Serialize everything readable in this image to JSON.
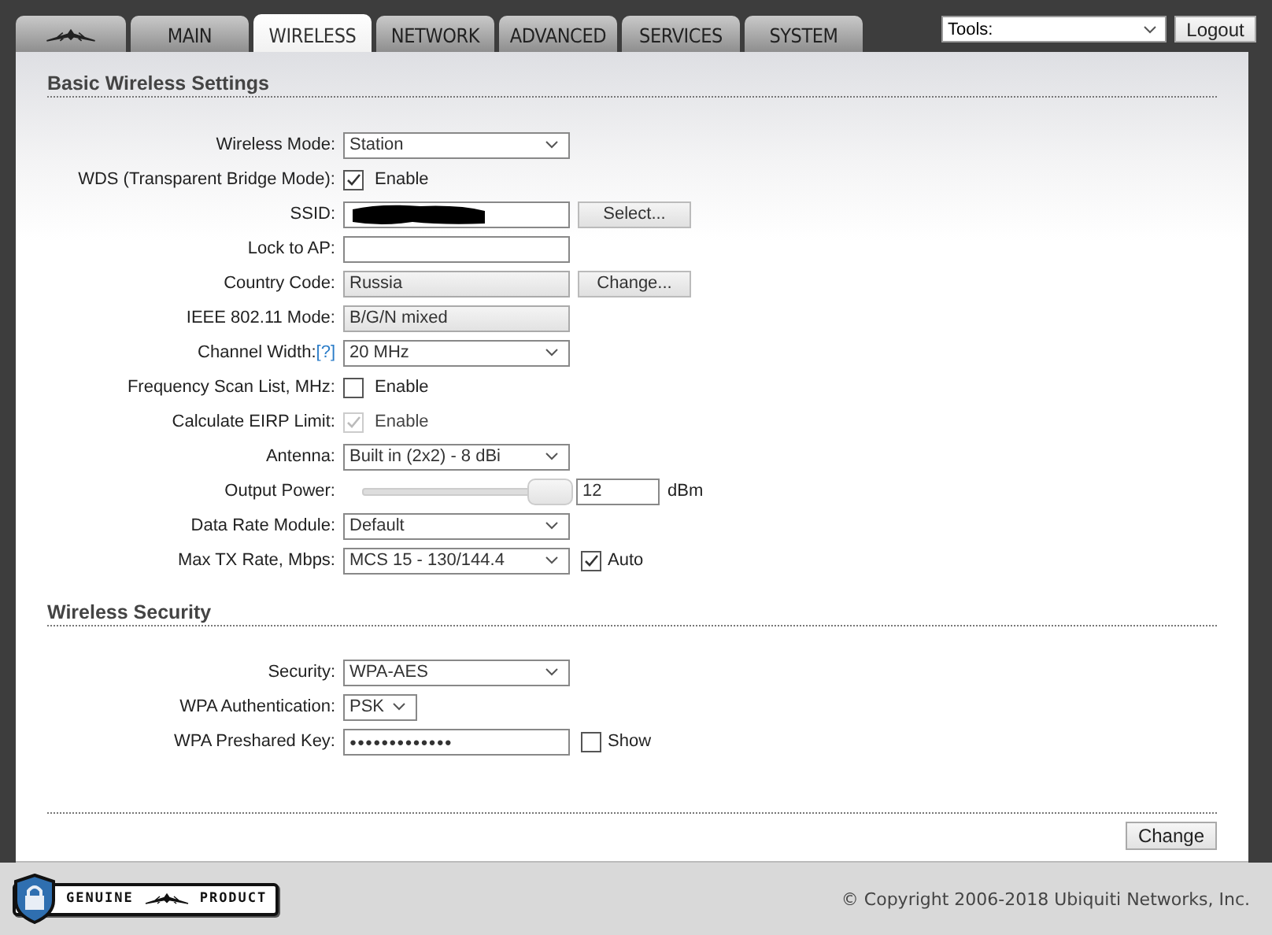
{
  "tabs": [
    {
      "kind": "logo",
      "selected": false
    },
    {
      "kind": "text",
      "label": "MAIN",
      "selected": false
    },
    {
      "kind": "text",
      "label": "WIRELESS",
      "selected": true
    },
    {
      "kind": "text",
      "label": "NETWORK",
      "selected": false
    },
    {
      "kind": "text",
      "label": "ADVANCED",
      "selected": false
    },
    {
      "kind": "text",
      "label": "SERVICES",
      "selected": false
    },
    {
      "kind": "text",
      "label": "SYSTEM",
      "selected": false
    }
  ],
  "tools": {
    "value": "Tools:"
  },
  "logout_button": "Logout",
  "sections": [
    {
      "title": "Basic Wireless Settings",
      "fields": [
        {
          "kind": "select",
          "label": "Wireless Mode:",
          "value": "Station"
        },
        {
          "kind": "checkbox",
          "label": "WDS (Transparent Bridge Mode):",
          "option": "Enable",
          "checked": true,
          "disabled": false
        },
        {
          "kind": "text",
          "label": "SSID:",
          "redacted": true,
          "button": "Select..."
        },
        {
          "kind": "text",
          "label": "Lock to AP:",
          "redacted": false
        },
        {
          "kind": "readonly",
          "label": "Country Code:",
          "value": "Russia",
          "button": "Change..."
        },
        {
          "kind": "readonly",
          "label": "IEEE 802.11 Mode:",
          "value": "B/G/N mixed"
        },
        {
          "kind": "select",
          "label": "Channel Width:",
          "help": "[?]",
          "value": "20 MHz"
        },
        {
          "kind": "checkbox",
          "label": "Frequency Scan List, MHz:",
          "option": "Enable",
          "checked": false,
          "disabled": false
        },
        {
          "kind": "checkbox",
          "label": "Calculate EIRP Limit:",
          "option": "Enable",
          "checked": true,
          "disabled": true
        },
        {
          "kind": "select",
          "label": "Antenna:",
          "value": "Built in (2x2) - 8 dBi"
        },
        {
          "kind": "slider",
          "label": "Output Power:",
          "level": 1.0,
          "value": "12",
          "unit": "dBm"
        },
        {
          "kind": "select",
          "label": "Data Rate Module:",
          "value": "Default"
        },
        {
          "kind": "select",
          "label": "Max TX Rate, Mbps:",
          "value": "MCS 15 - 130/144.4",
          "extra": {
            "option": "Auto",
            "checked": true
          }
        }
      ]
    },
    {
      "title": "Wireless Security",
      "fields": [
        {
          "kind": "select",
          "label": "Security:",
          "value": "WPA-AES"
        },
        {
          "kind": "select-small",
          "label": "WPA Authentication:",
          "value": "PSK"
        },
        {
          "kind": "password",
          "label": "WPA Preshared Key:",
          "value": "●●●●●●●●●●●●●",
          "extra": {
            "option": "Show",
            "checked": false
          }
        }
      ]
    }
  ],
  "change_button": "Change",
  "badge": {
    "left": "GENUINE",
    "right": "PRODUCT"
  },
  "copyright": "© Copyright 2006-2018 Ubiquiti Networks, Inc."
}
